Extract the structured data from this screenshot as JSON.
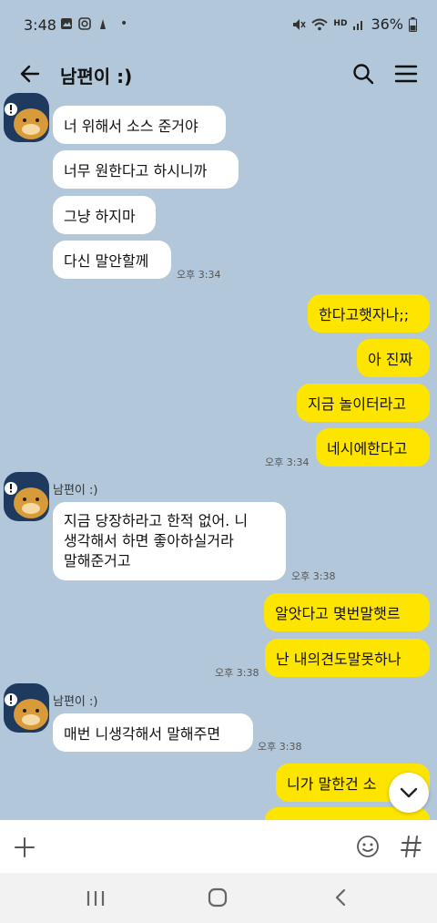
{
  "status_bar": {
    "time": "3:48",
    "dot": "•",
    "network": "HD",
    "battery": "36%"
  },
  "header": {
    "title": "남편이 :)"
  },
  "messages": [
    {
      "type": "in",
      "text": "너 위해서 소스 준거야"
    },
    {
      "type": "in",
      "text": "너무 원한다고 하시니까"
    },
    {
      "type": "in",
      "text": "그냥 하지마"
    },
    {
      "type": "in",
      "text": "다신 말안할께",
      "time": "오후 3:34"
    },
    {
      "type": "out",
      "text": "한다고햇자나;;"
    },
    {
      "type": "out",
      "text": "아 진짜"
    },
    {
      "type": "out",
      "text": "지금 놀이터라고"
    },
    {
      "type": "out",
      "text": "네시에한다고",
      "time": "오후 3:34"
    },
    {
      "type": "in",
      "sender": "남편이 :)",
      "lines": [
        "지금 당장하라고 한적 없어. 니",
        "생각해서 하면 좋아하실거라",
        "말해준거고"
      ],
      "time": "오후 3:38"
    },
    {
      "type": "out",
      "text": "알앗다고 몇번말햇르"
    },
    {
      "type": "out",
      "text": "난 내의견도말못하나",
      "time": "오후 3:38"
    },
    {
      "type": "in",
      "sender": "남편이 :)",
      "text": "매번 니생각해서 말해주면",
      "time": "오후 3:38"
    },
    {
      "type": "out",
      "text": "니가 말한건 소"
    }
  ],
  "input_bar": {
    "plus_icon": "plus-icon",
    "emoji_icon": "emoji-icon",
    "hash_icon": "hash-icon"
  },
  "nav_bar": {
    "recent": "recents-icon",
    "home": "home-icon",
    "back": "back-icon"
  }
}
